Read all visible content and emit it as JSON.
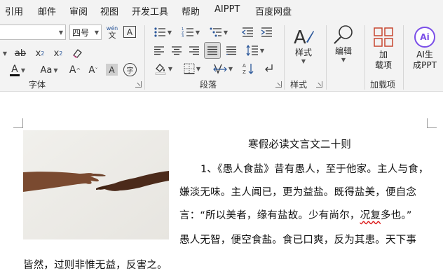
{
  "menu": [
    "引用",
    "邮件",
    "审阅",
    "视图",
    "开发工具",
    "帮助",
    "AIPPT",
    "百度网盘"
  ],
  "ribbon": {
    "font": {
      "name_value": "",
      "size_value": "四号",
      "phonetic_top": "wén",
      "phonetic_bottom": "文",
      "border_char": "A",
      "strike_label": "ab",
      "subscript_label": "x",
      "subscript_mark": "2",
      "superscript_label": "x",
      "superscript_mark": "2",
      "font_color_label": "A",
      "case_label": "Aa",
      "grow_label": "A",
      "shrink_label": "A",
      "shading_label": "A",
      "enclose_label": "字",
      "group_label": "字体"
    },
    "paragraph": {
      "group_label": "段落"
    },
    "styles": {
      "button_label": "样式",
      "group_label": "样式"
    },
    "editing": {
      "button_label": "编辑"
    },
    "addins": {
      "button_label_1": "加",
      "button_label_2": "载项",
      "group_label": "加载项"
    },
    "ai": {
      "logo_text": "Ai",
      "button_label_1": "AI生",
      "button_label_2": "成PPT"
    }
  },
  "document": {
    "title": "寒假必读文言文二十则",
    "lines": [
      "1、《愚人食盐》昔有愚人，至于他家。主人与食，",
      "嫌淡无味。主人闻已，更为益盐。既得盐美，便自念",
      "言：“所以美者，缘有盐故。少有尚尔，",
      "况复",
      "多也。”",
      "愚人无智，便空食盐。食已口爽，反为其患。天下事",
      "皆然，过则非惟无益，反害之。"
    ]
  },
  "colors": {
    "accent_blue": "#2b579a",
    "addin_red": "#c7462f",
    "ai_purple": "#7a4ee8",
    "font_color_bar": "#111111"
  }
}
